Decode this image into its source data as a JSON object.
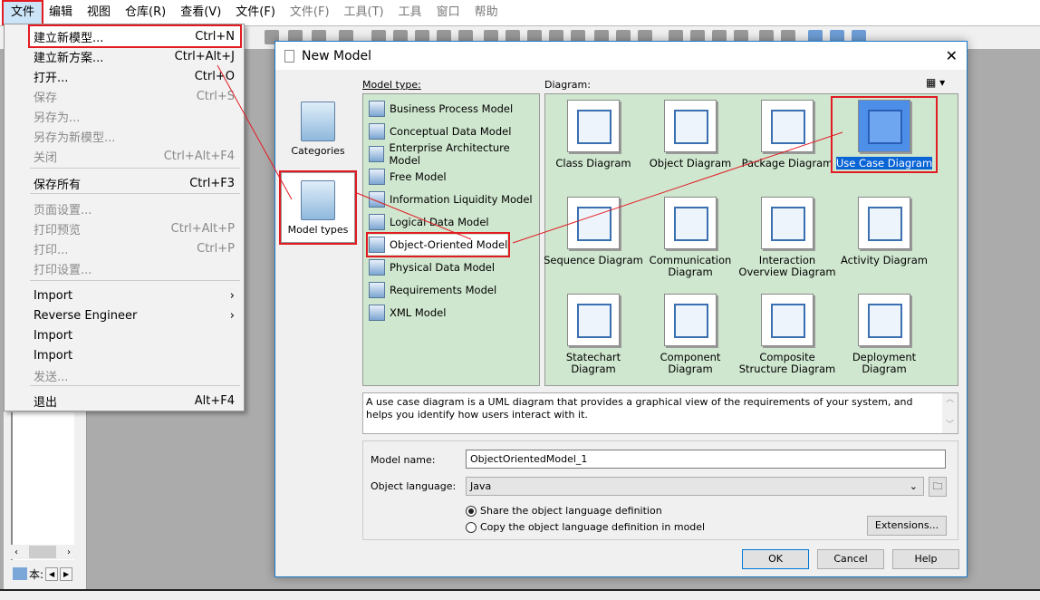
{
  "menubar": [
    "文件",
    "编辑",
    "视图",
    "仓库(R)",
    "查看(V)",
    "文件(F)",
    "文件(F)",
    "工具(T)",
    "工具",
    "窗口",
    "帮助"
  ],
  "file_menu": [
    {
      "label": "建立新模型...",
      "shortcut": "Ctrl+N",
      "enabled": true
    },
    {
      "label": "建立新方案...",
      "shortcut": "Ctrl+Alt+J",
      "enabled": true
    },
    {
      "label": "打开...",
      "shortcut": "Ctrl+O",
      "enabled": true
    },
    {
      "label": "保存",
      "shortcut": "Ctrl+S",
      "enabled": false
    },
    {
      "label": "另存为...",
      "shortcut": "",
      "enabled": false
    },
    {
      "label": "另存为新模型...",
      "shortcut": "",
      "enabled": false
    },
    {
      "label": "关闭",
      "shortcut": "Ctrl+Alt+F4",
      "enabled": false
    },
    {
      "label": "保存所有",
      "shortcut": "Ctrl+F3",
      "enabled": true
    },
    {
      "label": "页面设置...",
      "shortcut": "",
      "enabled": false
    },
    {
      "label": "打印预览",
      "shortcut": "Ctrl+Alt+P",
      "enabled": false
    },
    {
      "label": "打印...",
      "shortcut": "Ctrl+P",
      "enabled": false
    },
    {
      "label": "打印设置...",
      "shortcut": "",
      "enabled": false
    },
    {
      "label": "Import",
      "shortcut": "›",
      "enabled": true
    },
    {
      "label": "Reverse Engineer",
      "shortcut": "›",
      "enabled": true
    },
    {
      "label": "Import",
      "shortcut": "",
      "enabled": true
    },
    {
      "label": "Import",
      "shortcut": "",
      "enabled": true
    },
    {
      "label": "发送...",
      "shortcut": "",
      "enabled": false
    },
    {
      "label": "退出",
      "shortcut": "Alt+F4",
      "enabled": true
    }
  ],
  "left_pane": {
    "tab_label": "本:"
  },
  "dialog": {
    "title": "New Model",
    "close": "✕",
    "categories": [
      {
        "label": "Categories"
      },
      {
        "label": "Model types",
        "selected": true
      }
    ],
    "model_type_label": "Model type:",
    "diagram_label": "Diagram:",
    "model_types": [
      "Business Process Model",
      "Conceptual Data Model",
      "Enterprise Architecture Model",
      "Free Model",
      "Information Liquidity Model",
      "Logical Data Model",
      "Object-Oriented Model",
      "Physical Data Model",
      "Requirements Model",
      "XML Model"
    ],
    "selected_model_type": "Object-Oriented Model",
    "diagrams": [
      "Class Diagram",
      "Object Diagram",
      "Package Diagram",
      "Use Case Diagram",
      "Sequence Diagram",
      "Communication Diagram",
      "Interaction Overview Diagram",
      "Activity Diagram",
      "Statechart Diagram",
      "Component Diagram",
      "Composite Structure Diagram",
      "Deployment Diagram"
    ],
    "selected_diagram": "Use Case Diagram",
    "description": "A use case diagram is a UML diagram that provides a graphical view of the requirements of your system, and helps you identify how users interact with it.",
    "model_name_label": "Model name:",
    "model_name": "ObjectOrientedModel_1",
    "object_language_label": "Object language:",
    "object_language": "Java",
    "radio_share": "Share the object language definition",
    "radio_copy": "Copy the object language definition in model",
    "radio_selected": "share",
    "extensions": "Extensions...",
    "ok": "OK",
    "cancel": "Cancel",
    "help": "Help"
  },
  "colors": {
    "highlight": "#e21b23",
    "panel_green": "#cfe6cf",
    "selection": "#0a64d6"
  }
}
